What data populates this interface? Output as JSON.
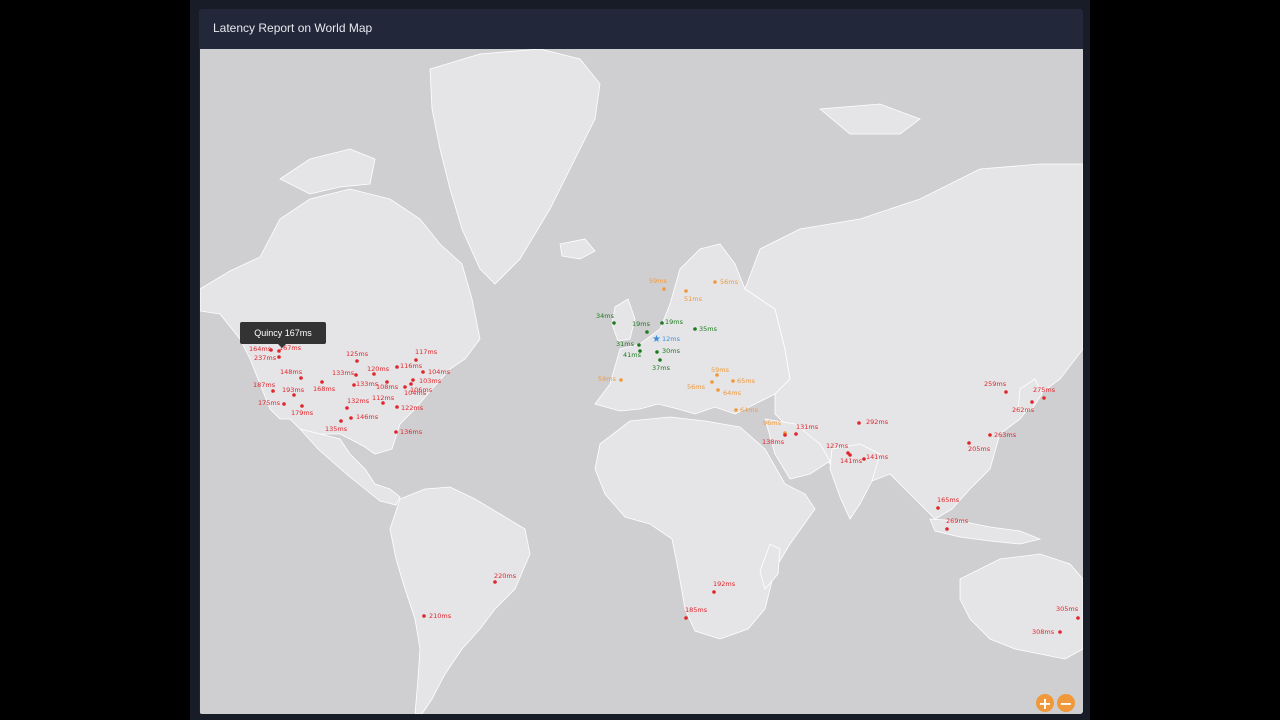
{
  "panel": {
    "title": "Latency Report on World Map"
  },
  "tooltip": {
    "text": "Quincy 167ms"
  },
  "zoom": {
    "in_label": "+",
    "out_label": "−"
  },
  "colors": {
    "background": "#000000",
    "panel": "#1f2433",
    "ocean": "#cfcfd2",
    "land": "#e5e5e7",
    "high_latency": "#e0252b",
    "medium_latency": "#f0993a",
    "low_latency": "#1f7a1f",
    "origin": "#3b8fe0",
    "zoom_button": "#f0993a"
  },
  "markers": [
    {
      "label": "164ms",
      "tier": "red"
    },
    {
      "label": "167ms",
      "tier": "red"
    },
    {
      "label": "237ms",
      "tier": "red"
    },
    {
      "label": "148ms",
      "tier": "red"
    },
    {
      "label": "187ms",
      "tier": "red"
    },
    {
      "label": "193ms",
      "tier": "red"
    },
    {
      "label": "175ms",
      "tier": "red"
    },
    {
      "label": "179ms",
      "tier": "red"
    },
    {
      "label": "168ms",
      "tier": "red"
    },
    {
      "label": "125ms",
      "tier": "red"
    },
    {
      "label": "120ms",
      "tier": "red"
    },
    {
      "label": "133ms",
      "tier": "red"
    },
    {
      "label": "133ms",
      "tier": "red"
    },
    {
      "label": "116ms",
      "tier": "red"
    },
    {
      "label": "117ms",
      "tier": "red"
    },
    {
      "label": "104ms",
      "tier": "red"
    },
    {
      "label": "103ms",
      "tier": "red"
    },
    {
      "label": "106ms",
      "tier": "red"
    },
    {
      "label": "108ms",
      "tier": "red"
    },
    {
      "label": "104ms",
      "tier": "red"
    },
    {
      "label": "132ms",
      "tier": "red"
    },
    {
      "label": "112ms",
      "tier": "red"
    },
    {
      "label": "122ms",
      "tier": "red"
    },
    {
      "label": "146ms",
      "tier": "red"
    },
    {
      "label": "135ms",
      "tier": "red"
    },
    {
      "label": "136ms",
      "tier": "red"
    },
    {
      "label": "220ms",
      "tier": "red"
    },
    {
      "label": "210ms",
      "tier": "red"
    },
    {
      "label": "59ms",
      "tier": "orange"
    },
    {
      "label": "56ms",
      "tier": "orange"
    },
    {
      "label": "51ms",
      "tier": "orange"
    },
    {
      "label": "34ms",
      "tier": "green"
    },
    {
      "label": "19ms",
      "tier": "green"
    },
    {
      "label": "19ms",
      "tier": "green"
    },
    {
      "label": "35ms",
      "tier": "green"
    },
    {
      "label": "31ms",
      "tier": "green"
    },
    {
      "label": "12ms",
      "tier": "blue"
    },
    {
      "label": "41ms",
      "tier": "green"
    },
    {
      "label": "30ms",
      "tier": "green"
    },
    {
      "label": "37ms",
      "tier": "green"
    },
    {
      "label": "59ms",
      "tier": "orange"
    },
    {
      "label": "59ms",
      "tier": "orange"
    },
    {
      "label": "56ms",
      "tier": "orange"
    },
    {
      "label": "65ms",
      "tier": "orange"
    },
    {
      "label": "64ms",
      "tier": "orange"
    },
    {
      "label": "64ms",
      "tier": "orange"
    },
    {
      "label": "96ms",
      "tier": "orange"
    },
    {
      "label": "131ms",
      "tier": "red"
    },
    {
      "label": "138ms",
      "tier": "red"
    },
    {
      "label": "127ms",
      "tier": "red"
    },
    {
      "label": "141ms",
      "tier": "red"
    },
    {
      "label": "141ms",
      "tier": "red"
    },
    {
      "label": "292ms",
      "tier": "red"
    },
    {
      "label": "259ms",
      "tier": "red"
    },
    {
      "label": "275ms",
      "tier": "red"
    },
    {
      "label": "262ms",
      "tier": "red"
    },
    {
      "label": "263ms",
      "tier": "red"
    },
    {
      "label": "205ms",
      "tier": "red"
    },
    {
      "label": "165ms",
      "tier": "red"
    },
    {
      "label": "269ms",
      "tier": "red"
    },
    {
      "label": "192ms",
      "tier": "red"
    },
    {
      "label": "185ms",
      "tier": "red"
    },
    {
      "label": "305ms",
      "tier": "red"
    },
    {
      "label": "308ms",
      "tier": "red"
    }
  ]
}
